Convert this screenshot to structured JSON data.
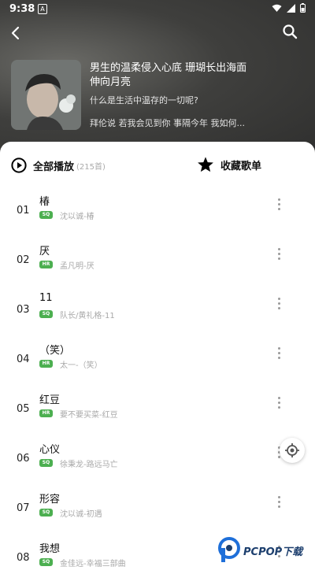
{
  "status_bar": {
    "time": "9:38"
  },
  "playlist": {
    "title": "男生的温柔侵入心底 珊瑚长出海面伸向月亮",
    "description": "什么是生活中温存的一切呢?",
    "artists": "拜伦说 若我会见到你 事隔今年 我如何..."
  },
  "actions": {
    "play_all_label": "全部播放",
    "count": "(215首)",
    "collect_label": "收藏歌单"
  },
  "songs": [
    {
      "index": "01",
      "title": "椿",
      "badge": "SQ",
      "sub": "沈以诚-椿"
    },
    {
      "index": "02",
      "title": "厌",
      "badge": "HR",
      "sub": "孟凡明-厌"
    },
    {
      "index": "03",
      "title": "11",
      "badge": "SQ",
      "sub": "队长/黄礼格-11"
    },
    {
      "index": "04",
      "title": "（笑）",
      "badge": "HR",
      "sub": "太一-（笑）"
    },
    {
      "index": "05",
      "title": "红豆",
      "badge": "HR",
      "sub": "要不要买菜-红豆"
    },
    {
      "index": "06",
      "title": "心仪",
      "badge": "SQ",
      "sub": "徐秉龙-路远马亡"
    },
    {
      "index": "07",
      "title": "形容",
      "badge": "SQ",
      "sub": "沈以诚-初遇"
    },
    {
      "index": "08",
      "title": "我想",
      "badge": "SQ",
      "sub": "金佳远-幸福三部曲"
    }
  ],
  "watermark": {
    "text": "PCPOP下载"
  },
  "colors": {
    "badge_green": "#4caf50",
    "header_dark": "#3f3f3d",
    "watermark_blue": "#1d3f6e"
  },
  "icons": [
    "back-icon",
    "search-icon",
    "play-circle-icon",
    "star-icon",
    "more-vertical-icon",
    "locate-icon"
  ]
}
